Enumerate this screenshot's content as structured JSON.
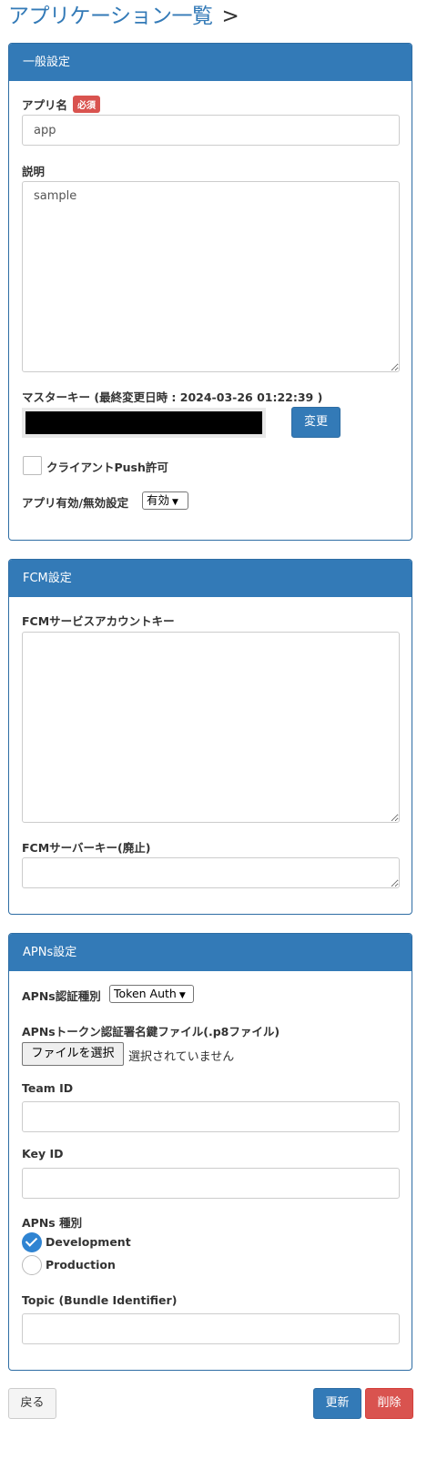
{
  "header": {
    "title": "アプリケーション一覧",
    "separator": ">"
  },
  "general": {
    "heading": "一般設定",
    "app_name_label": "アプリ名",
    "required_badge": "必須",
    "app_name_value": "app",
    "description_label": "説明",
    "description_value": "sample",
    "master_key_label": "マスターキー (最終変更日時 : 2024-03-26 01:22:39 )",
    "change_button": "変更",
    "client_push_label": "クライアントPush許可",
    "client_push_checked": false,
    "enable_label": "アプリ有効/無効設定",
    "enable_value": "有効"
  },
  "fcm": {
    "heading": "FCM設定",
    "service_account_label": "FCMサービスアカウントキー",
    "server_key_label": "FCMサーバーキー(廃止)"
  },
  "apns": {
    "heading": "APNs設定",
    "auth_type_label": "APNs認証種別",
    "auth_type_value": "Token Auth",
    "p8_label": "APNsトークン認証署名鍵ファイル(.p8ファイル)",
    "file_button": "ファイルを選択",
    "file_status": "選択されていません",
    "team_id_label": "Team ID",
    "key_id_label": "Key ID",
    "type_label": "APNs 種別",
    "type_options": [
      "Development",
      "Production"
    ],
    "type_selected": "Development",
    "topic_label": "Topic (Bundle Identifier)"
  },
  "footer": {
    "back": "戻る",
    "update": "更新",
    "delete": "削除"
  },
  "colors": {
    "primary": "#337ab7",
    "danger": "#d9534f",
    "radio_checked": "#2f84d2"
  },
  "icons": {
    "dropdown": "chevron-down-icon",
    "radio_checked": "check-icon"
  }
}
